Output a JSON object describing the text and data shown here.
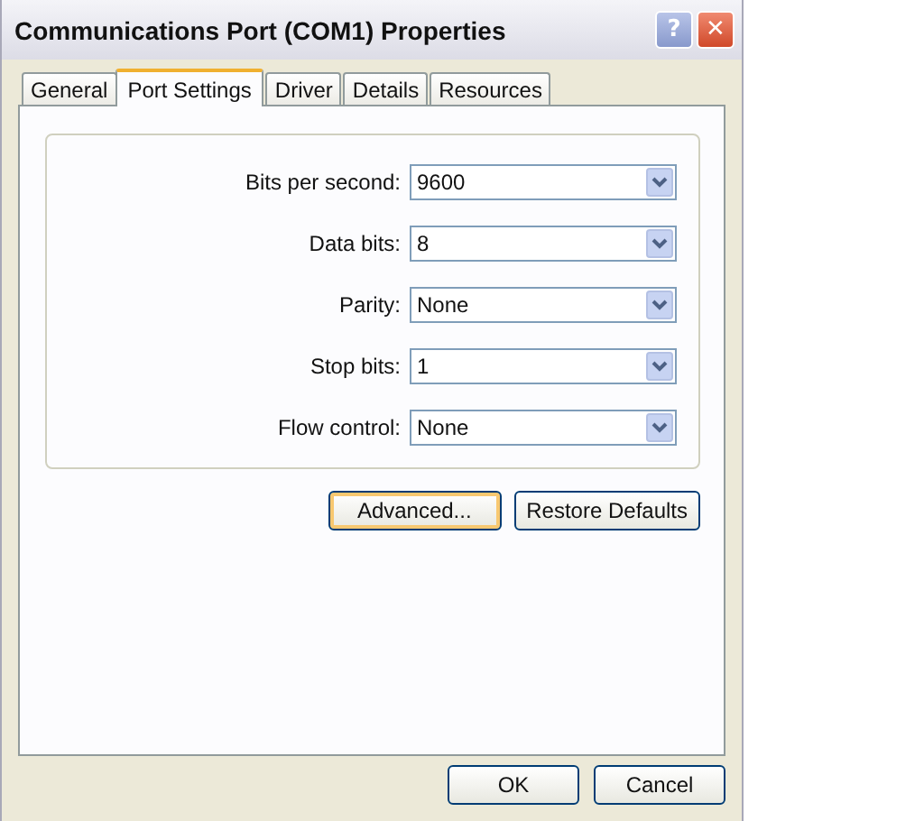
{
  "window": {
    "title": "Communications Port (COM1) Properties",
    "title_buttons": [
      "?",
      "✕"
    ]
  },
  "tabs": [
    {
      "label": "General",
      "selected": false
    },
    {
      "label": "Port Settings",
      "selected": true
    },
    {
      "label": "Driver",
      "selected": false
    },
    {
      "label": "Details",
      "selected": false
    },
    {
      "label": "Resources",
      "selected": false
    }
  ],
  "settings": [
    {
      "label": "Bits per second:",
      "value": "9600"
    },
    {
      "label": "Data bits:",
      "value": "8"
    },
    {
      "label": "Parity:",
      "value": "None"
    },
    {
      "label": "Stop bits:",
      "value": "1"
    },
    {
      "label": "Flow control:",
      "value": "None"
    }
  ],
  "panel_buttons": [
    {
      "label": "Advanced...",
      "focused": true
    },
    {
      "label": "Restore Defaults",
      "focused": false
    }
  ],
  "dialog_buttons": [
    {
      "label": "OK",
      "focused": false
    },
    {
      "label": "Cancel",
      "focused": false
    }
  ]
}
